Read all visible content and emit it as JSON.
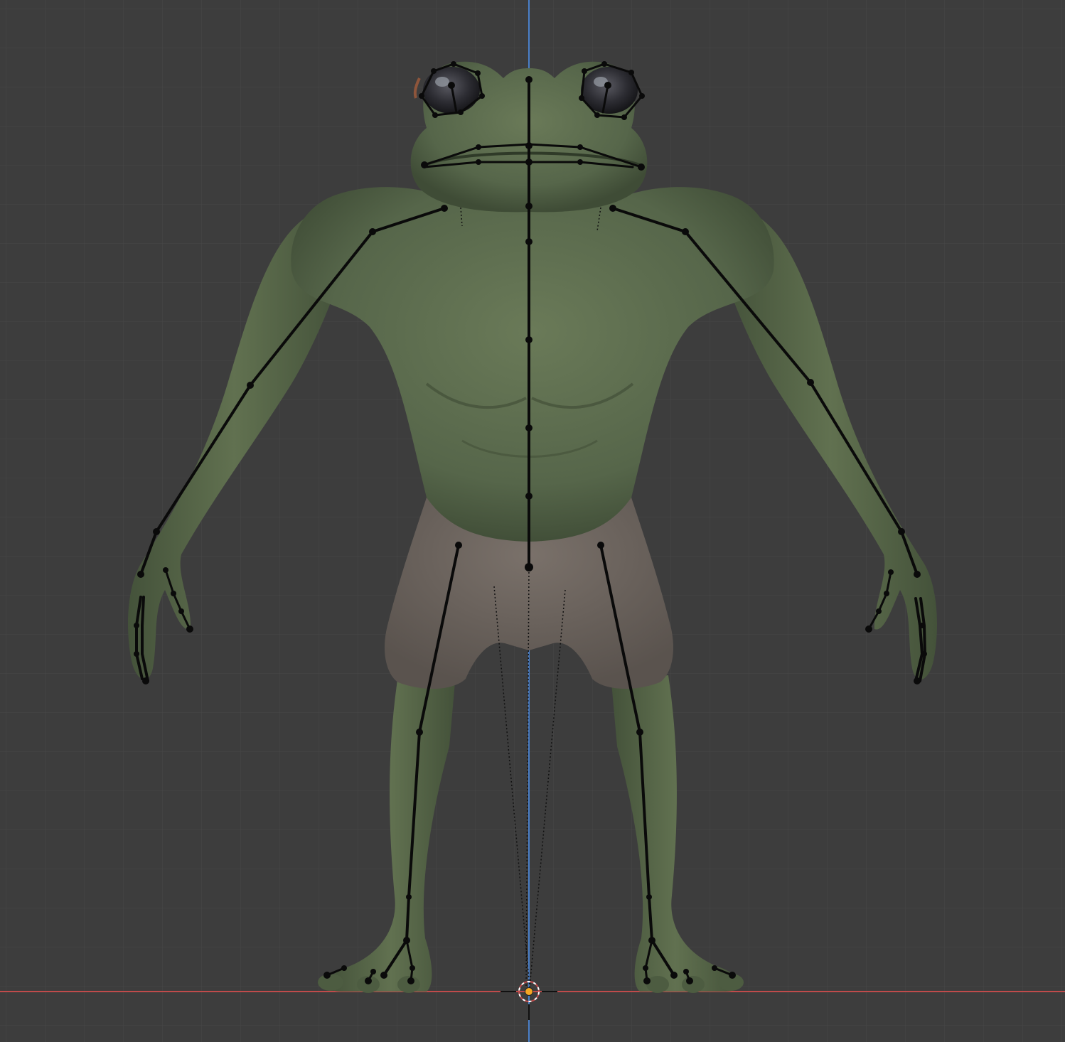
{
  "viewport": {
    "mode": "3D Viewport",
    "view": "front-orthographic",
    "background_color": "#3d3d3d",
    "grid_color": "#4a4a4a",
    "grid_major_color": "#515151",
    "x_axis_color": "#c04b4b",
    "z_axis_color": "#4a7fc9",
    "origin_color": "#f5a623"
  },
  "objects": [
    {
      "name": "frog-character-mesh",
      "type": "mesh"
    },
    {
      "name": "armature-rig",
      "type": "armature"
    }
  ],
  "materials": {
    "skin_color": "#5b6b4c",
    "skin_shadow_color": "#3f4c35",
    "shorts_color": "#6e6660",
    "eye_color": "#2a2a2e"
  }
}
